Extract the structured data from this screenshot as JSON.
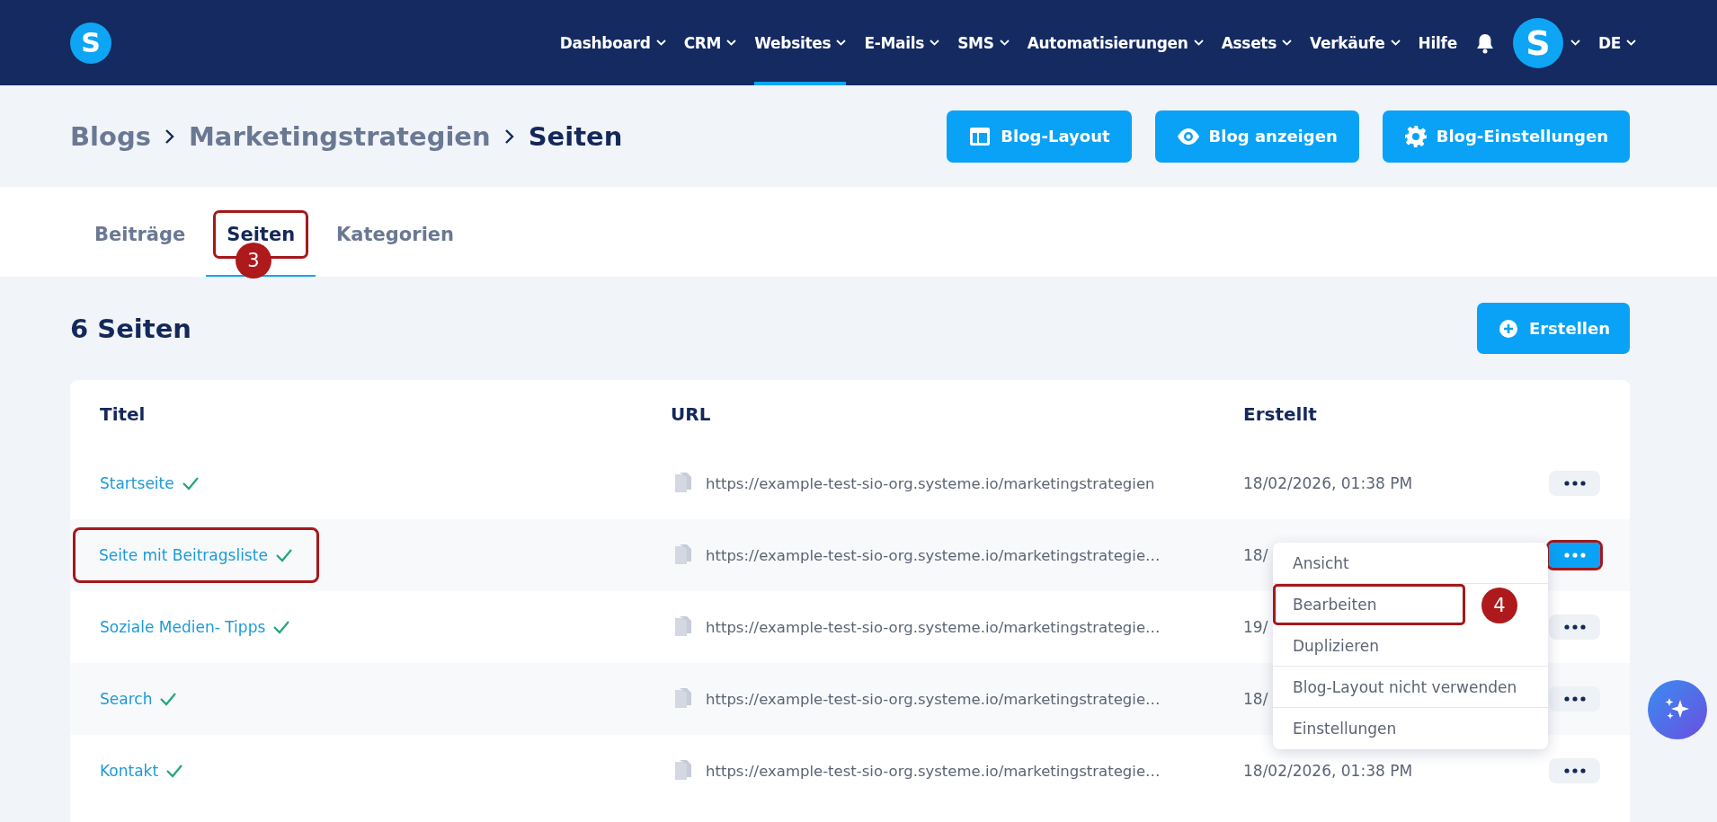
{
  "nav": {
    "logo": "S",
    "items": [
      {
        "label": "Dashboard",
        "caret": true,
        "selected": false
      },
      {
        "label": "CRM",
        "caret": true,
        "selected": false
      },
      {
        "label": "Websites",
        "caret": true,
        "selected": true
      },
      {
        "label": "E-Mails",
        "caret": true,
        "selected": false
      },
      {
        "label": "SMS",
        "caret": true,
        "selected": false
      },
      {
        "label": "Automatisierungen",
        "caret": true,
        "selected": false
      },
      {
        "label": "Assets",
        "caret": true,
        "selected": false
      },
      {
        "label": "Verkäufe",
        "caret": true,
        "selected": false
      },
      {
        "label": "Hilfe",
        "caret": false,
        "selected": false
      }
    ],
    "avatar": "S",
    "language": "DE"
  },
  "breadcrumb": [
    "Blogs",
    "Marketingstrategien",
    "Seiten"
  ],
  "header_buttons": [
    {
      "label": "Blog-Layout"
    },
    {
      "label": "Blog anzeigen"
    },
    {
      "label": "Blog-Einstellungen"
    }
  ],
  "tabs": [
    {
      "label": "Beiträge",
      "selected": false,
      "highlighted": false
    },
    {
      "label": "Seiten",
      "selected": true,
      "highlighted": true,
      "annotation": "3"
    },
    {
      "label": "Kategorien",
      "selected": false,
      "highlighted": false
    }
  ],
  "count_title": "6 Seiten",
  "create_button": "Erstellen",
  "table": {
    "columns": [
      "Titel",
      "URL",
      "Erstellt"
    ],
    "rows": [
      {
        "title": "Startseite",
        "highlighted": false,
        "url": "https://example-test-sio-org.systeme.io/marketingstrategien",
        "created": "18/02/2026, 01:38 PM",
        "menu_open": false
      },
      {
        "title": "Seite mit Beitragsliste",
        "highlighted": true,
        "url": "https://example-test-sio-org.systeme.io/marketingstrategie…",
        "created": "18/",
        "menu_open": true
      },
      {
        "title": "Soziale Medien- Tipps",
        "highlighted": false,
        "url": "https://example-test-sio-org.systeme.io/marketingstrategie…",
        "created": "19/",
        "menu_open": false
      },
      {
        "title": "Search",
        "highlighted": false,
        "url": "https://example-test-sio-org.systeme.io/marketingstrategie…",
        "created": "18/",
        "menu_open": false
      },
      {
        "title": "Kontakt",
        "highlighted": false,
        "url": "https://example-test-sio-org.systeme.io/marketingstrategie…",
        "created": "18/02/2026, 01:38 PM",
        "menu_open": false
      }
    ]
  },
  "menu": {
    "items": [
      {
        "label": "Ansicht",
        "highlighted": false
      },
      {
        "label": "Bearbeiten",
        "highlighted": true,
        "annotation": "4"
      },
      {
        "label": "Duplizieren",
        "highlighted": false
      },
      {
        "label": "Blog-Layout nicht verwenden",
        "highlighted": false
      },
      {
        "label": "Einstellungen",
        "highlighted": false
      }
    ]
  }
}
